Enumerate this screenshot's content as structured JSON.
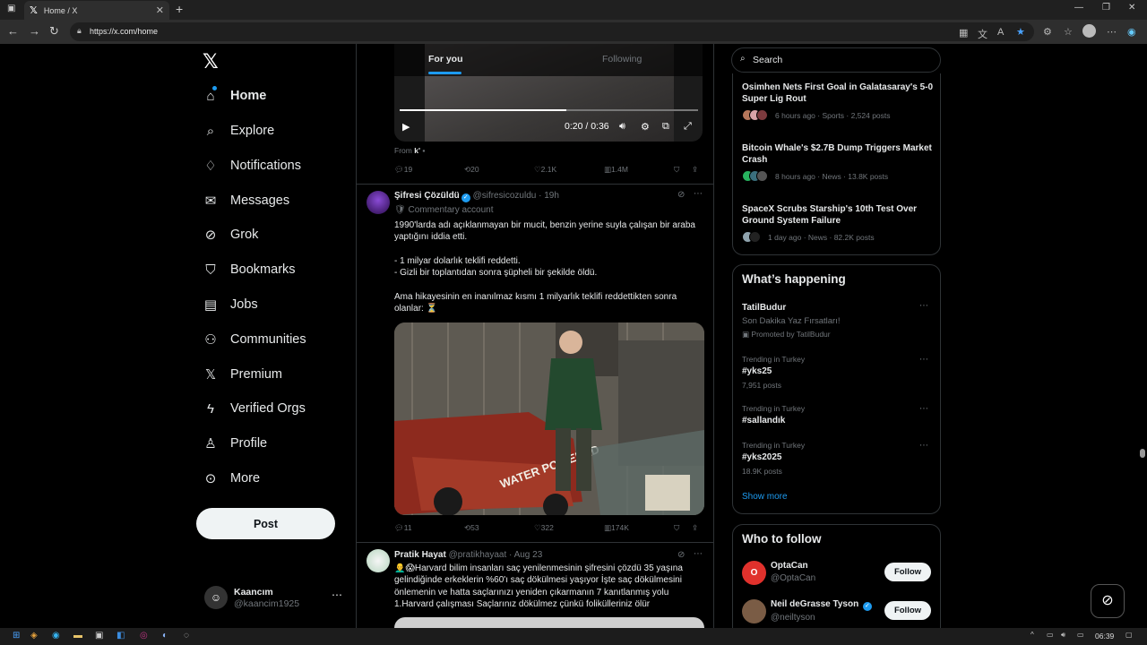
{
  "browser": {
    "tab_title": "Home / X",
    "url": "https://x.com/home"
  },
  "sidebar": {
    "items": [
      {
        "label": "Home",
        "icon": "home-icon"
      },
      {
        "label": "Explore",
        "icon": "search-icon"
      },
      {
        "label": "Notifications",
        "icon": "bell-icon"
      },
      {
        "label": "Messages",
        "icon": "envelope-icon"
      },
      {
        "label": "Grok",
        "icon": "grok-icon"
      },
      {
        "label": "Bookmarks",
        "icon": "bookmark-icon"
      },
      {
        "label": "Jobs",
        "icon": "briefcase-icon"
      },
      {
        "label": "Communities",
        "icon": "people-icon"
      },
      {
        "label": "Premium",
        "icon": "x-icon"
      },
      {
        "label": "Verified Orgs",
        "icon": "lightning-icon"
      },
      {
        "label": "Profile",
        "icon": "person-icon"
      },
      {
        "label": "More",
        "icon": "more-circle-icon"
      }
    ],
    "post_label": "Post",
    "account": {
      "name": "Kaancım",
      "handle": "@kaancim1925"
    }
  },
  "feed": {
    "tabs": {
      "for_you": "For you",
      "following": "Following"
    },
    "video": {
      "time": "0:20 / 0:36",
      "progress": 0.56
    },
    "from_label": "From",
    "from_name": "k'",
    "tweet0_actions": {
      "replies": "19",
      "reposts": "20",
      "likes": "2.1K",
      "views": "1.4M"
    },
    "tweet1": {
      "name": "Şifresi Çözüldü",
      "handle": "@sifresicozuldu",
      "time": "19h",
      "label": "Commentary account",
      "text": "1990'larda adı açıklanmayan bir mucit, benzin yerine suyla çalışan bir araba yaptığını iddia etti.\n\n- 1 milyar dolarlık teklifi reddetti.\n- Gizli bir toplantıdan sonra şüpheli bir şekilde öldü.\n\nAma hikayesinin en inanılmaz kısmı 1 milyarlık teklifi reddettikten sonra olanlar: ⏳",
      "actions": {
        "replies": "11",
        "reposts": "53",
        "likes": "322",
        "views": "174K"
      }
    },
    "tweet2": {
      "name": "Pratik Hayat",
      "handle": "@pratikhayaat",
      "time": "Aug 23",
      "text": "👨‍🦲😱Harvard bilim insanları saç yenilenmesinin şifresini çözdü 35 yaşına gelindiğinde erkeklerin %60'ı saç dökülmesi yaşıyor İşte saç dökülmesini önlemenin ve hatta saçlarınızı yeniden çıkarmanın 7 kanıtlanmış yolu\n1.Harvard çalışması Saçlarınız dökülmez çünkü folikülleriniz ölür"
    }
  },
  "right": {
    "search_placeholder": "Search",
    "news": [
      {
        "title": "Osimhen Nets First Goal in Galatasaray's 5-0 Super Lig Rout",
        "meta": "6 hours ago · Sports · 2,524 posts"
      },
      {
        "title": "Bitcoin Whale's $2.7B Dump Triggers Market Crash",
        "meta": "8 hours ago · News · 13.8K posts"
      },
      {
        "title": "SpaceX Scrubs Starship's 10th Test Over Ground System Failure",
        "meta": "1 day ago · News · 82.2K posts"
      }
    ],
    "happening": {
      "title": "What’s happening",
      "promo": {
        "name": "TatilBudur",
        "tagline": "Son Dakika Yaz Fırsatları!",
        "promoted": "Promoted by TatilBudur"
      },
      "trends": [
        {
          "category": "Trending in Turkey",
          "tag": "#yks25",
          "posts": "7,951 posts"
        },
        {
          "category": "Trending in Turkey",
          "tag": "#sallandık",
          "posts": ""
        },
        {
          "category": "Trending in Turkey",
          "tag": "#yks2025",
          "posts": "18.9K posts"
        }
      ],
      "show_more": "Show more"
    },
    "who_to_follow": {
      "title": "Who to follow",
      "accounts": [
        {
          "name": "OptaCan",
          "handle": "@OptaCan",
          "button": "Follow"
        },
        {
          "name": "Neil deGrasse Tyson",
          "handle": "@neiltyson",
          "button": "Follow"
        }
      ]
    }
  },
  "taskbar": {
    "time": "06:39"
  },
  "colors": {
    "accent": "#1d9bf0",
    "background": "#000000",
    "border": "#2f3336",
    "muted": "#71767b"
  }
}
